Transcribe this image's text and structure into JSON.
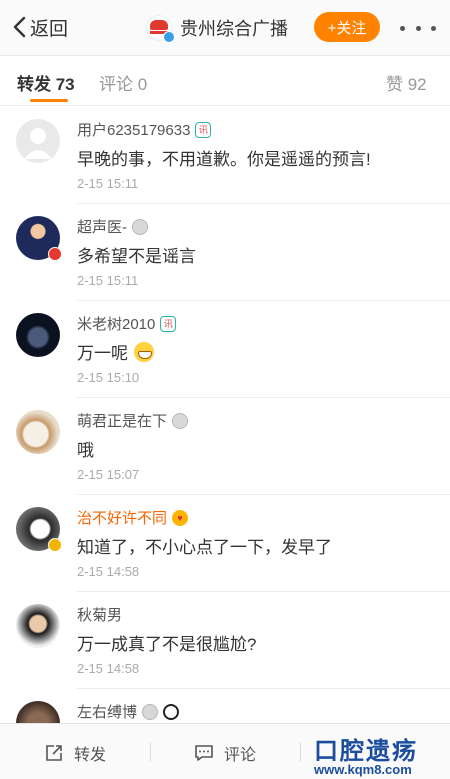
{
  "nav": {
    "back_label": "返回",
    "account_name": "贵州综合广播",
    "follow_label": "+关注"
  },
  "tabs": {
    "repost": "转发 73",
    "comment": "评论 0",
    "like": "赞 92"
  },
  "comments": [
    {
      "user": "用户6235179633",
      "text": "早晚的事，不用道歉。你是遥遥的预言!",
      "time": "2-15 15:11",
      "badge": "shield-badge-icon"
    },
    {
      "user": "超声医-",
      "text": "多希望不是谣言",
      "time": "2-15 15:11",
      "badge": "medal-badge-icon"
    },
    {
      "user": "米老树2010",
      "text": "万一呢",
      "time": "2-15 15:10",
      "badge": "shield-badge-icon",
      "emoji": "grin-emoji-icon"
    },
    {
      "user": "萌君正是在下",
      "text": "哦",
      "time": "2-15 15:07",
      "badge": "medal-badge-icon"
    },
    {
      "user": "治不好许不同",
      "text": "知道了，不小心点了一下，发早了",
      "time": "2-15 14:58",
      "badge": "heart-eyes-badge-icon",
      "vip": true
    },
    {
      "user": "秋菊男",
      "text": "万一成真了不是很尴尬?",
      "time": "2-15 14:58"
    },
    {
      "user": "左右缚博",
      "text": "",
      "time": "",
      "badge": "medal-badge-icon"
    }
  ],
  "bottom": {
    "repost_label": "转发",
    "comment_label": "评论"
  },
  "watermark": {
    "text": "口腔遗疡",
    "url": "www.kqm8.com"
  },
  "colors": {
    "accent": "#ff8200",
    "vip_name": "#f86400",
    "watermark": "#1a4d9e"
  }
}
